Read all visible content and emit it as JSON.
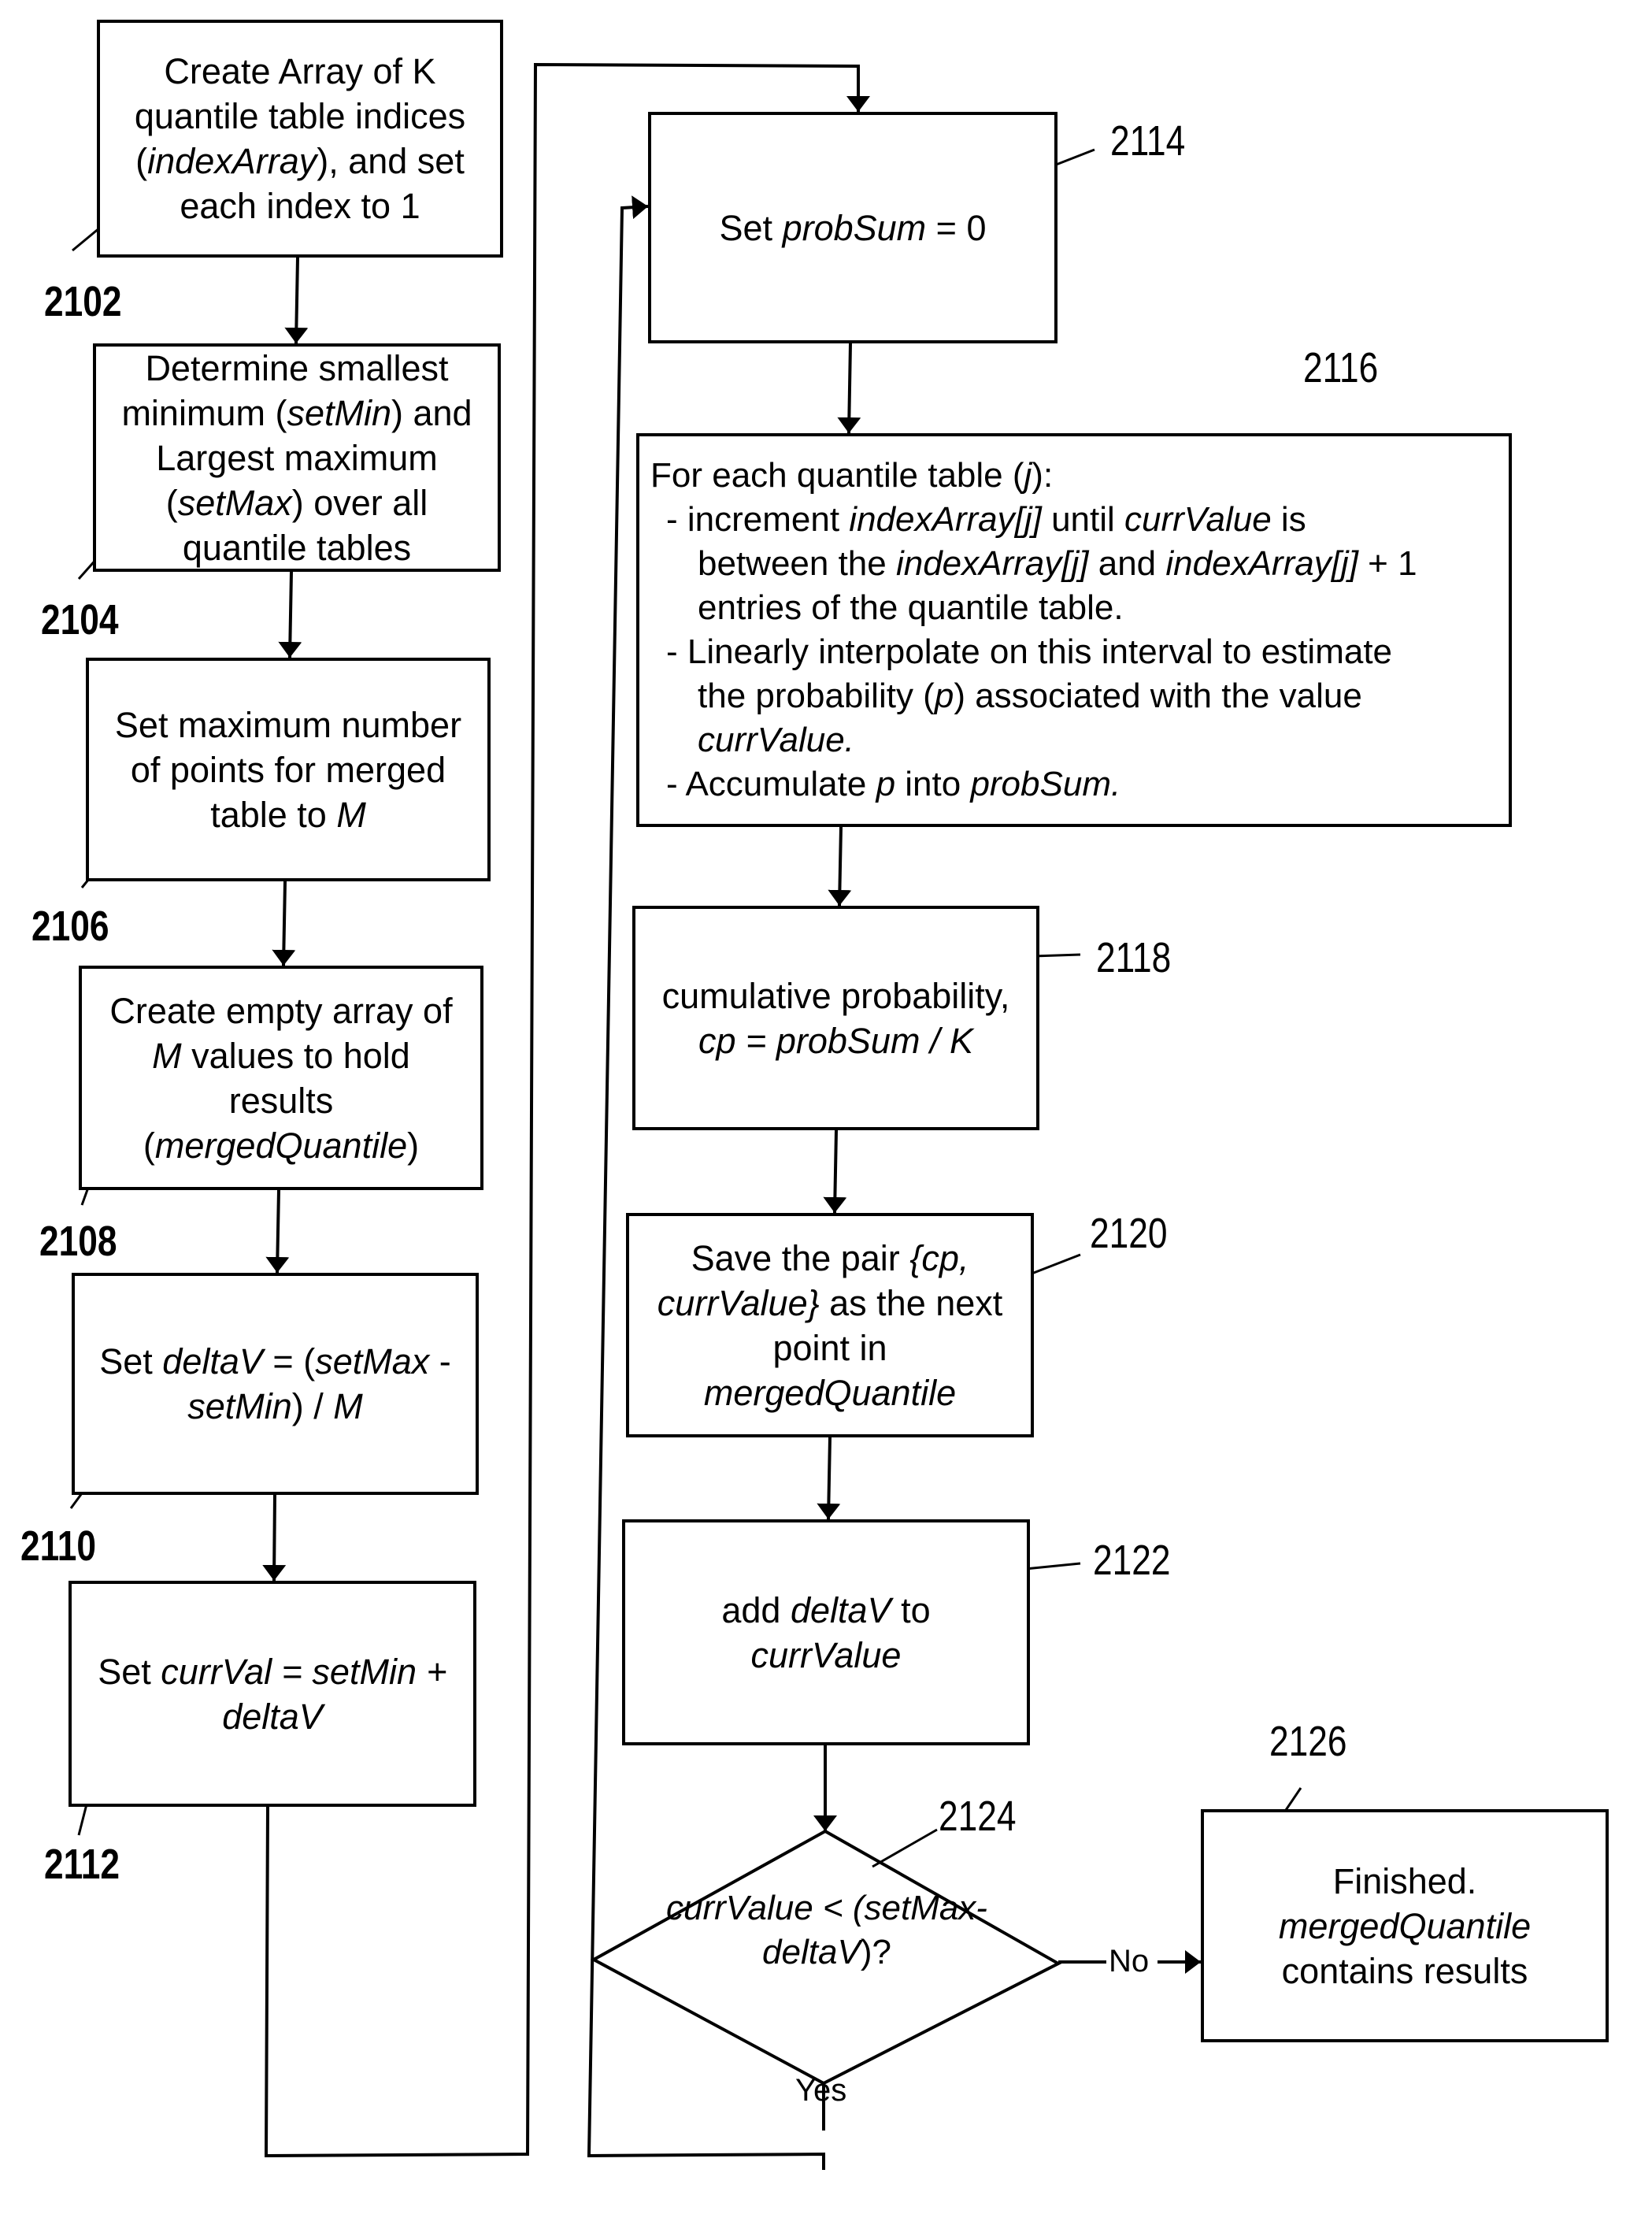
{
  "figure": {
    "steps": [
      {
        "id": "2102",
        "lines": [
          [
            {
              "t": "Create Array of K"
            }
          ],
          [
            {
              "t": "quantile table indices"
            }
          ],
          [
            {
              "t": "("
            },
            {
              "t": "indexArray",
              "i": true
            },
            {
              "t": "), and set"
            }
          ],
          [
            {
              "t": "each index to 1"
            }
          ]
        ]
      },
      {
        "id": "2104",
        "lines": [
          [
            {
              "t": "Determine smallest"
            }
          ],
          [
            {
              "t": "minimum ("
            },
            {
              "t": "setMin",
              "i": true
            },
            {
              "t": ") and"
            }
          ],
          [
            {
              "t": "Largest maximum"
            }
          ],
          [
            {
              "t": "("
            },
            {
              "t": "setMax",
              "i": true
            },
            {
              "t": ") over all"
            }
          ],
          [
            {
              "t": "quantile tables"
            }
          ]
        ]
      },
      {
        "id": "2106",
        "lines": [
          [
            {
              "t": "Set maximum number"
            }
          ],
          [
            {
              "t": "of points for merged"
            }
          ],
          [
            {
              "t": "table to "
            },
            {
              "t": "M",
              "i": true
            }
          ]
        ]
      },
      {
        "id": "2108",
        "lines": [
          [
            {
              "t": "Create empty array of"
            }
          ],
          [
            {
              "t": "M",
              "i": true
            },
            {
              "t": " values to hold"
            }
          ],
          [
            {
              "t": "results"
            }
          ],
          [
            {
              "t": "("
            },
            {
              "t": "mergedQuantile",
              "i": true
            },
            {
              "t": ")"
            }
          ]
        ]
      },
      {
        "id": "2110",
        "lines": [
          [
            {
              "t": "Set "
            },
            {
              "t": "deltaV",
              "i": true
            },
            {
              "t": " = ("
            },
            {
              "t": "setMax",
              "i": true
            },
            {
              "t": " -"
            }
          ],
          [
            {
              "t": "setMin",
              "i": true
            },
            {
              "t": ") / "
            },
            {
              "t": "M",
              "i": true
            }
          ]
        ]
      },
      {
        "id": "2112",
        "lines": [
          [
            {
              "t": "Set "
            },
            {
              "t": "currVal = setMin +",
              "i": true
            }
          ],
          [
            {
              "t": "deltaV",
              "i": true
            }
          ]
        ]
      },
      {
        "id": "2114",
        "lines": [
          [
            {
              "t": "Set "
            },
            {
              "t": "probSum",
              "i": true
            },
            {
              "t": " = 0"
            }
          ]
        ]
      },
      {
        "id": "2116",
        "lines": [
          [
            {
              "t": "For each quantile table ("
            },
            {
              "t": "j",
              "i": true
            },
            {
              "t": "):"
            }
          ],
          [
            {
              "t": "- increment "
            },
            {
              "t": "indexArray[j]",
              "i": true
            },
            {
              "t": " until "
            },
            {
              "t": "currValue",
              "i": true
            },
            {
              "t": " is"
            }
          ],
          [
            {
              "t": "between the "
            },
            {
              "t": "indexArray[j]",
              "i": true
            },
            {
              "t": " and "
            },
            {
              "t": "indexArray[j]",
              "i": true
            },
            {
              "t": " + 1"
            }
          ],
          [
            {
              "t": "entries of the quantile table."
            }
          ],
          [
            {
              "t": "- Linearly interpolate on this interval to estimate"
            }
          ],
          [
            {
              "t": "the probability ("
            },
            {
              "t": "p",
              "i": true
            },
            {
              "t": ") associated with the value"
            }
          ],
          [
            {
              "t": "currValue.",
              "i": true
            }
          ],
          [
            {
              "t": "- Accumulate "
            },
            {
              "t": "p",
              "i": true
            },
            {
              "t": " into "
            },
            {
              "t": "probSum.",
              "i": true
            }
          ]
        ]
      },
      {
        "id": "2118",
        "lines": [
          [
            {
              "t": "cumulative probability,"
            }
          ],
          [
            {
              "t": "cp = probSum / K",
              "i": true
            }
          ]
        ]
      },
      {
        "id": "2120",
        "lines": [
          [
            {
              "t": "Save the pair "
            },
            {
              "t": "{cp,",
              "i": true
            }
          ],
          [
            {
              "t": "currValue}",
              "i": true
            },
            {
              "t": " as the next"
            }
          ],
          [
            {
              "t": "point in"
            }
          ],
          [
            {
              "t": "mergedQuantile",
              "i": true
            }
          ]
        ]
      },
      {
        "id": "2122",
        "lines": [
          [
            {
              "t": "add "
            },
            {
              "t": "deltaV",
              "i": true
            },
            {
              "t": " to"
            }
          ],
          [
            {
              "t": "currValue",
              "i": true
            }
          ]
        ]
      },
      {
        "id": "2124",
        "lines": [
          [
            {
              "t": "currValue < (setMax-",
              "i": true
            }
          ],
          [
            {
              "t": "deltaV",
              "i": true
            },
            {
              "t": ")?"
            }
          ]
        ]
      },
      {
        "id": "2126",
        "lines": [
          [
            {
              "t": "Finished."
            }
          ],
          [
            {
              "t": "mergedQuantile",
              "i": true
            }
          ],
          [
            {
              "t": "contains results"
            }
          ]
        ]
      }
    ],
    "refs": [
      "2102",
      "2104",
      "2106",
      "2108",
      "2110",
      "2112",
      "2114",
      "2116",
      "2118",
      "2120",
      "2122",
      "2124",
      "2126"
    ],
    "branch_labels": {
      "yes": "Yes",
      "no": "No"
    }
  }
}
